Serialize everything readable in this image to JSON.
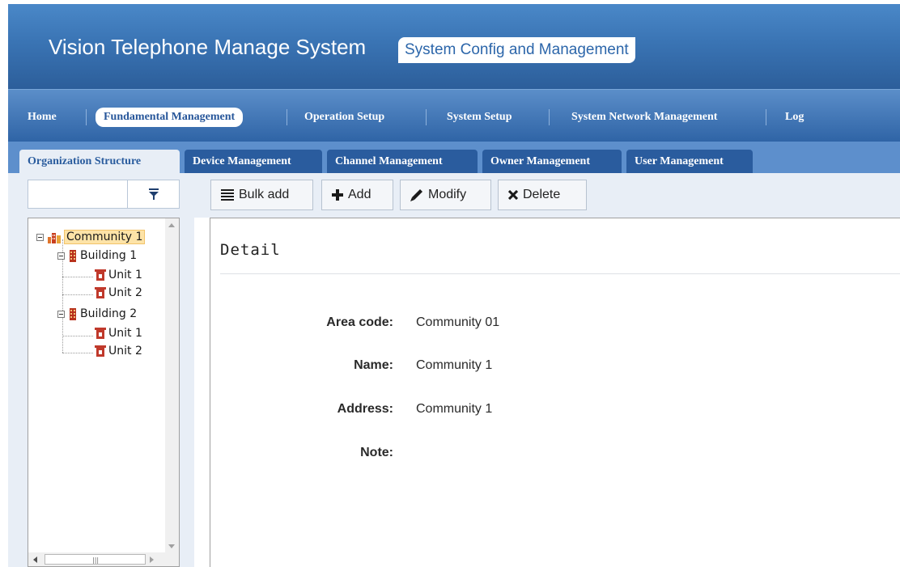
{
  "app": {
    "title": "Vision Telephone Manage System",
    "subtitle": "System Config and Management"
  },
  "main_nav": {
    "items": [
      {
        "label": "Home",
        "active": false
      },
      {
        "label": "Fundamental Management",
        "active": true
      },
      {
        "label": "Operation Setup",
        "active": false
      },
      {
        "label": "System Setup",
        "active": false
      },
      {
        "label": "System Network Management",
        "active": false
      },
      {
        "label": "Log",
        "active": false
      }
    ]
  },
  "sub_tabs": {
    "items": [
      {
        "label": "Organization Structure",
        "active": true
      },
      {
        "label": "Device Management",
        "active": false
      },
      {
        "label": "Channel Management",
        "active": false
      },
      {
        "label": "Owner Management",
        "active": false
      },
      {
        "label": "User Management",
        "active": false
      }
    ]
  },
  "filter": {
    "value": "",
    "placeholder": "",
    "icon": "filter-icon"
  },
  "tree": {
    "nodes": [
      {
        "label": "Community 1",
        "icon": "community-icon",
        "level": 0,
        "selected": true
      },
      {
        "label": "Building 1",
        "icon": "building-icon",
        "level": 1
      },
      {
        "label": "Unit 1",
        "icon": "unit-icon",
        "level": 2
      },
      {
        "label": "Unit 2",
        "icon": "unit-icon",
        "level": 2
      },
      {
        "label": "Building 2",
        "icon": "building-icon",
        "level": 1
      },
      {
        "label": "Unit 1",
        "icon": "unit-icon",
        "level": 2
      },
      {
        "label": "Unit 2",
        "icon": "unit-icon",
        "level": 2
      }
    ]
  },
  "toolbar": {
    "bulk_add": "Bulk add",
    "add": "Add",
    "modify": "Modify",
    "delete": "Delete"
  },
  "detail": {
    "title": "Detail",
    "fields": [
      {
        "label": "Area code:",
        "value": "Community 01"
      },
      {
        "label": "Name:",
        "value": "Community 1"
      },
      {
        "label": "Address:",
        "value": "Community 1"
      },
      {
        "label": "Note:",
        "value": ""
      }
    ]
  },
  "colors": {
    "header_blue": "#3a74b4",
    "nav_blue": "#2f64a6",
    "tab_dark": "#2a5c9e",
    "panel_bg": "#e8eef6",
    "selection": "#fde3a7"
  }
}
